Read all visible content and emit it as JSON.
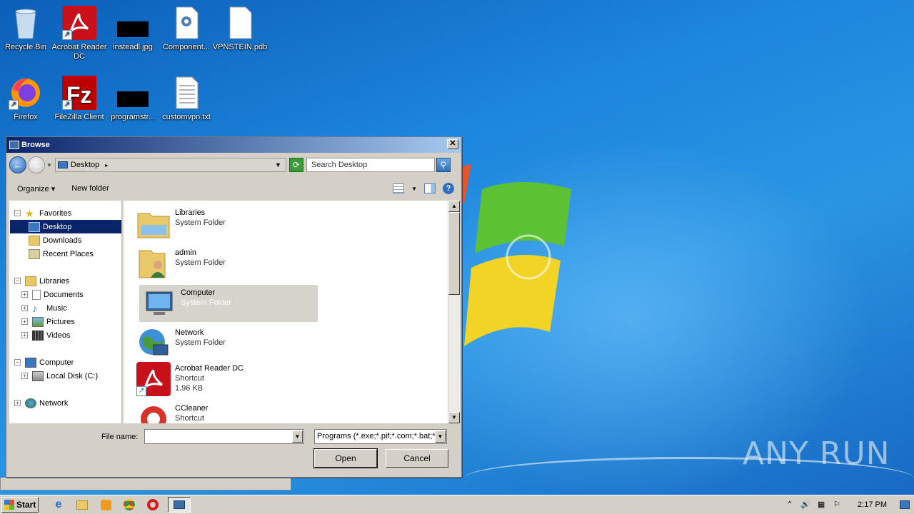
{
  "desktop": {
    "icons": [
      {
        "label": "Recycle Bin"
      },
      {
        "label": "Acrobat Reader DC"
      },
      {
        "label": "insteadl.jpg"
      },
      {
        "label": "Component..."
      },
      {
        "label": "VPNSTEIN.pdb"
      },
      {
        "label": "Firefox"
      },
      {
        "label": "FileZilla Client"
      },
      {
        "label": "programstr..."
      },
      {
        "label": "customvpn.txt"
      }
    ],
    "watermark": "ANY RUN"
  },
  "dialog": {
    "title": "Browse",
    "close_label": "✕",
    "address": {
      "location": "Desktop",
      "separator": "▸"
    },
    "search_placeholder": "Search Desktop",
    "toolbar": {
      "organize": "Organize ▾",
      "new_folder": "New folder"
    },
    "tree": [
      {
        "label": "Favorites",
        "expander": "−"
      },
      {
        "label": "Desktop",
        "selected": true
      },
      {
        "label": "Downloads"
      },
      {
        "label": "Recent Places"
      },
      {
        "label": "Libraries",
        "expander": "−"
      },
      {
        "label": "Documents",
        "expander": "+"
      },
      {
        "label": "Music",
        "expander": "+"
      },
      {
        "label": "Pictures",
        "expander": "+"
      },
      {
        "label": "Videos",
        "expander": "+"
      },
      {
        "label": "Computer",
        "expander": "−"
      },
      {
        "label": "Local Disk (C:)",
        "expander": "+"
      },
      {
        "label": "Network",
        "expander": "+"
      }
    ],
    "files": [
      {
        "name": "Libraries",
        "type": "System Folder",
        "size": ""
      },
      {
        "name": "admin",
        "type": "System Folder",
        "size": ""
      },
      {
        "name": "Computer",
        "type": "System Folder",
        "size": "",
        "hover": true
      },
      {
        "name": "Network",
        "type": "System Folder",
        "size": ""
      },
      {
        "name": "Acrobat Reader DC",
        "type": "Shortcut",
        "size": "1.96 KB"
      },
      {
        "name": "CCleaner",
        "type": "Shortcut",
        "size": ""
      }
    ],
    "file_name_label": "File name:",
    "file_name_value": "",
    "file_type": "Programs (*.exe;*.pif;*.com;*.bat;*.cmd)",
    "open_label": "Open",
    "cancel_label": "Cancel"
  },
  "taskbar": {
    "start_label": "Start",
    "clock": "2:17 PM"
  }
}
